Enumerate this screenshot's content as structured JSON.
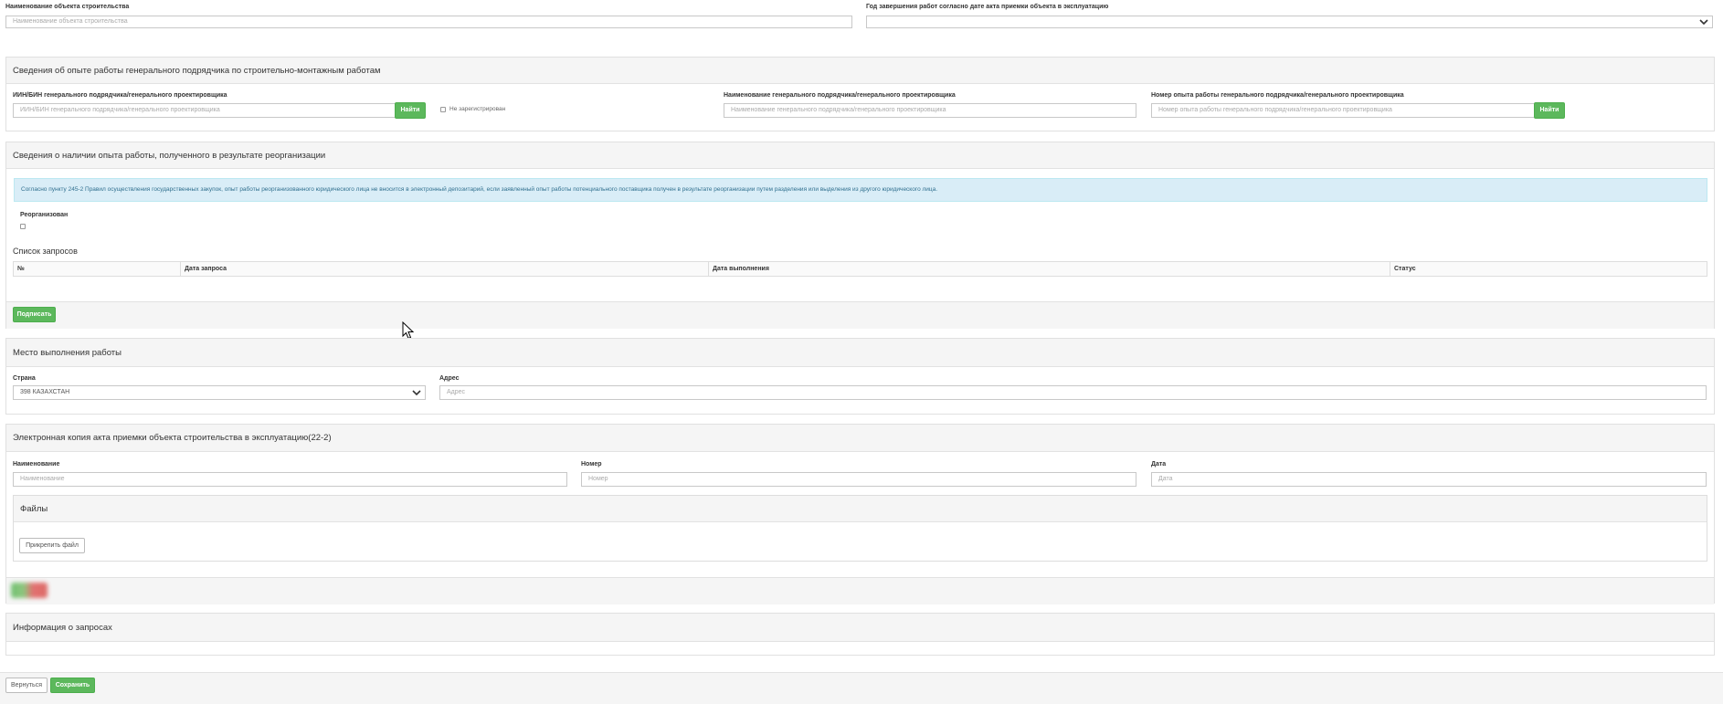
{
  "top": {
    "object_name_label": "Наименование объекта строительства",
    "object_name_placeholder": "Наименование объекта строительства",
    "year_label": "Год завершения работ согласно дате акта приемки объекта в эксплуатацию",
    "year_value": ""
  },
  "experience": {
    "title": "Сведения об опыте работы генерального подрядчика по строительно-монтажным работам",
    "iin_label": "ИИН/БИН генерального подрядчика/генерального проектировщика",
    "iin_placeholder": "ИИН/БИН генерального подрядчика/генерального проектировщика",
    "find_button": "Найти",
    "not_registered_label": "Не зарегистрирован",
    "name_label": "Наименование генерального подрядчика/генерального проектировщика",
    "name_placeholder": "Наименование генерального подрядчика/генерального проектировщика",
    "number_label": "Номер опыта работы генерального подрядчика/генерального проектировщика",
    "number_placeholder": "Номер опыта работы генерального подрядчика/генерального проектировщика",
    "find_button_2": "Найти"
  },
  "reorg": {
    "title": "Сведения о наличии опыта работы, полученного в результате реорганизации",
    "info_text": "Согласно пункту 245-2 Правил осуществления государственных закупок, опыт работы реорганизованного юридического лица не вносится в электронный депозитарий, если заявленный опыт работы потенциального поставщика получен в результате реорганизации путем разделения или выделения из другого юридического лица.",
    "reorganized_label": "Реорганизован",
    "requests_title": "Список запросов",
    "columns": [
      "№",
      "Дата запроса",
      "Дата выполнения",
      "Статус"
    ],
    "sign_button": "Подписать"
  },
  "place": {
    "title": "Место выполнения работы",
    "country_label": "Страна",
    "country_value": "398 КАЗАХСТАН",
    "address_label": "Адрес",
    "address_placeholder": "Адрес"
  },
  "ecopy": {
    "title": "Электронная копия акта приемки объекта строительства в эксплуатацию(22-2)",
    "name_label": "Наименование",
    "name_placeholder": "Наименование",
    "number_label": "Номер",
    "number_placeholder": "Номер",
    "date_label": "Дата",
    "date_placeholder": "Дата",
    "files_title": "Файлы",
    "attach_button": "Прикрепить файл"
  },
  "info": {
    "title": "Информация о запросах"
  },
  "footer": {
    "back_button": "Вернуться",
    "save_button": "Сохранить"
  }
}
